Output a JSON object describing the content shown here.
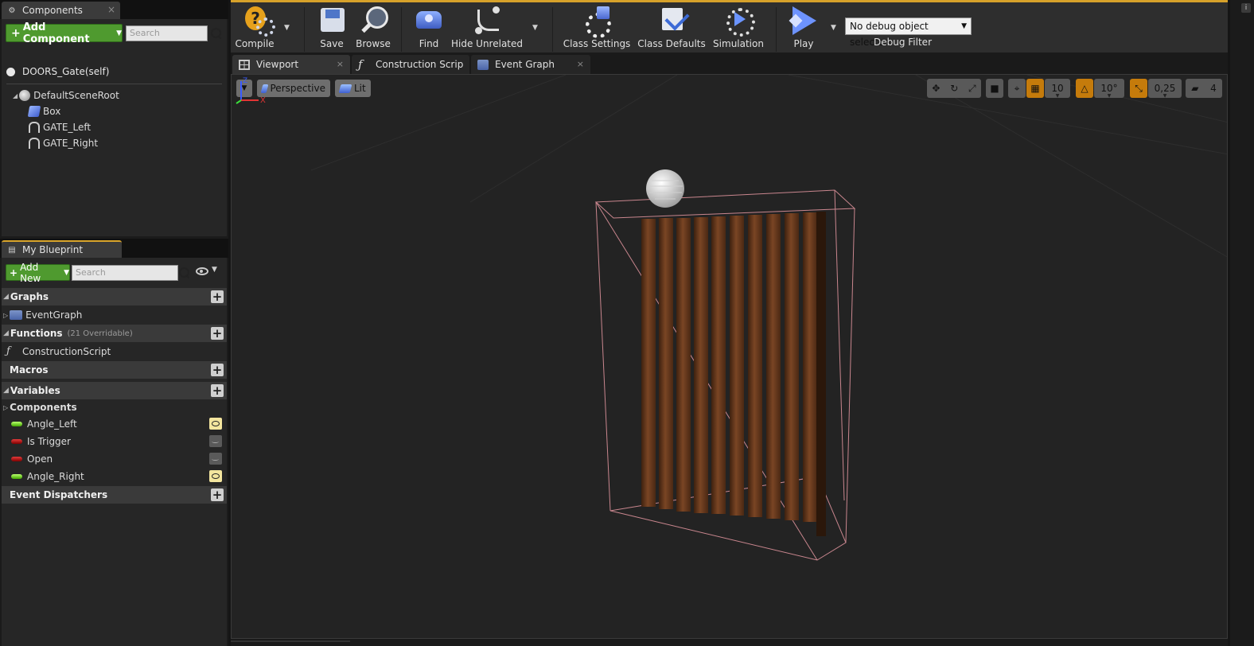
{
  "components_panel": {
    "title": "Components",
    "add_component_label": "Add Component",
    "search_placeholder": "Search",
    "self_item": "DOORS_Gate(self)",
    "tree": [
      {
        "label": "DefaultSceneRoot",
        "icon": "scene-root-icon"
      },
      {
        "label": "Box",
        "icon": "box-icon"
      },
      {
        "label": "GATE_Left",
        "icon": "static-mesh-icon"
      },
      {
        "label": "GATE_Right",
        "icon": "static-mesh-icon"
      }
    ]
  },
  "my_blueprint": {
    "title": "My Blueprint",
    "add_new_label": "Add New",
    "search_placeholder": "Search",
    "sections": {
      "graphs": "Graphs",
      "graph_item": "EventGraph",
      "functions": "Functions",
      "functions_note": "(21 Overridable)",
      "function_item": "ConstructionScript",
      "macros": "Macros",
      "variables": "Variables",
      "components": "Components",
      "event_dispatchers": "Event Dispatchers"
    },
    "variables": [
      {
        "name": "Angle_Left",
        "type_color": "#7ed321",
        "visible": true
      },
      {
        "name": "Is Trigger",
        "type_color": "#a00000",
        "visible": false
      },
      {
        "name": "Open",
        "type_color": "#a00000",
        "visible": false
      },
      {
        "name": "Angle_Right",
        "type_color": "#7ed321",
        "visible": true
      }
    ]
  },
  "toolbar": {
    "compile": "Compile",
    "save": "Save",
    "browse": "Browse",
    "find": "Find",
    "hide_unrelated": "Hide Unrelated",
    "class_settings": "Class Settings",
    "class_defaults": "Class Defaults",
    "simulation": "Simulation",
    "play": "Play",
    "debug_select": "No debug object selected",
    "debug_filter_label": "Debug Filter"
  },
  "editor_tabs": [
    {
      "label": "Viewport",
      "icon": "viewport-icon",
      "active": true
    },
    {
      "label": "Construction Scrip",
      "icon": "function-icon",
      "active": false
    },
    {
      "label": "Event Graph",
      "icon": "event-graph-icon",
      "active": false
    }
  ],
  "viewport": {
    "perspective_label": "Perspective",
    "lit_label": "Lit",
    "grid_snap": "10",
    "rotation_snap": "10°",
    "scale_snap": "0,25",
    "camera_speed": "4",
    "axis_x": "X",
    "axis_z": "Z"
  },
  "colors": {
    "accent": "#d6a12a",
    "add_button": "#4f9a2f",
    "wood": "#6b3b1f",
    "bounds": "#c9868e"
  }
}
